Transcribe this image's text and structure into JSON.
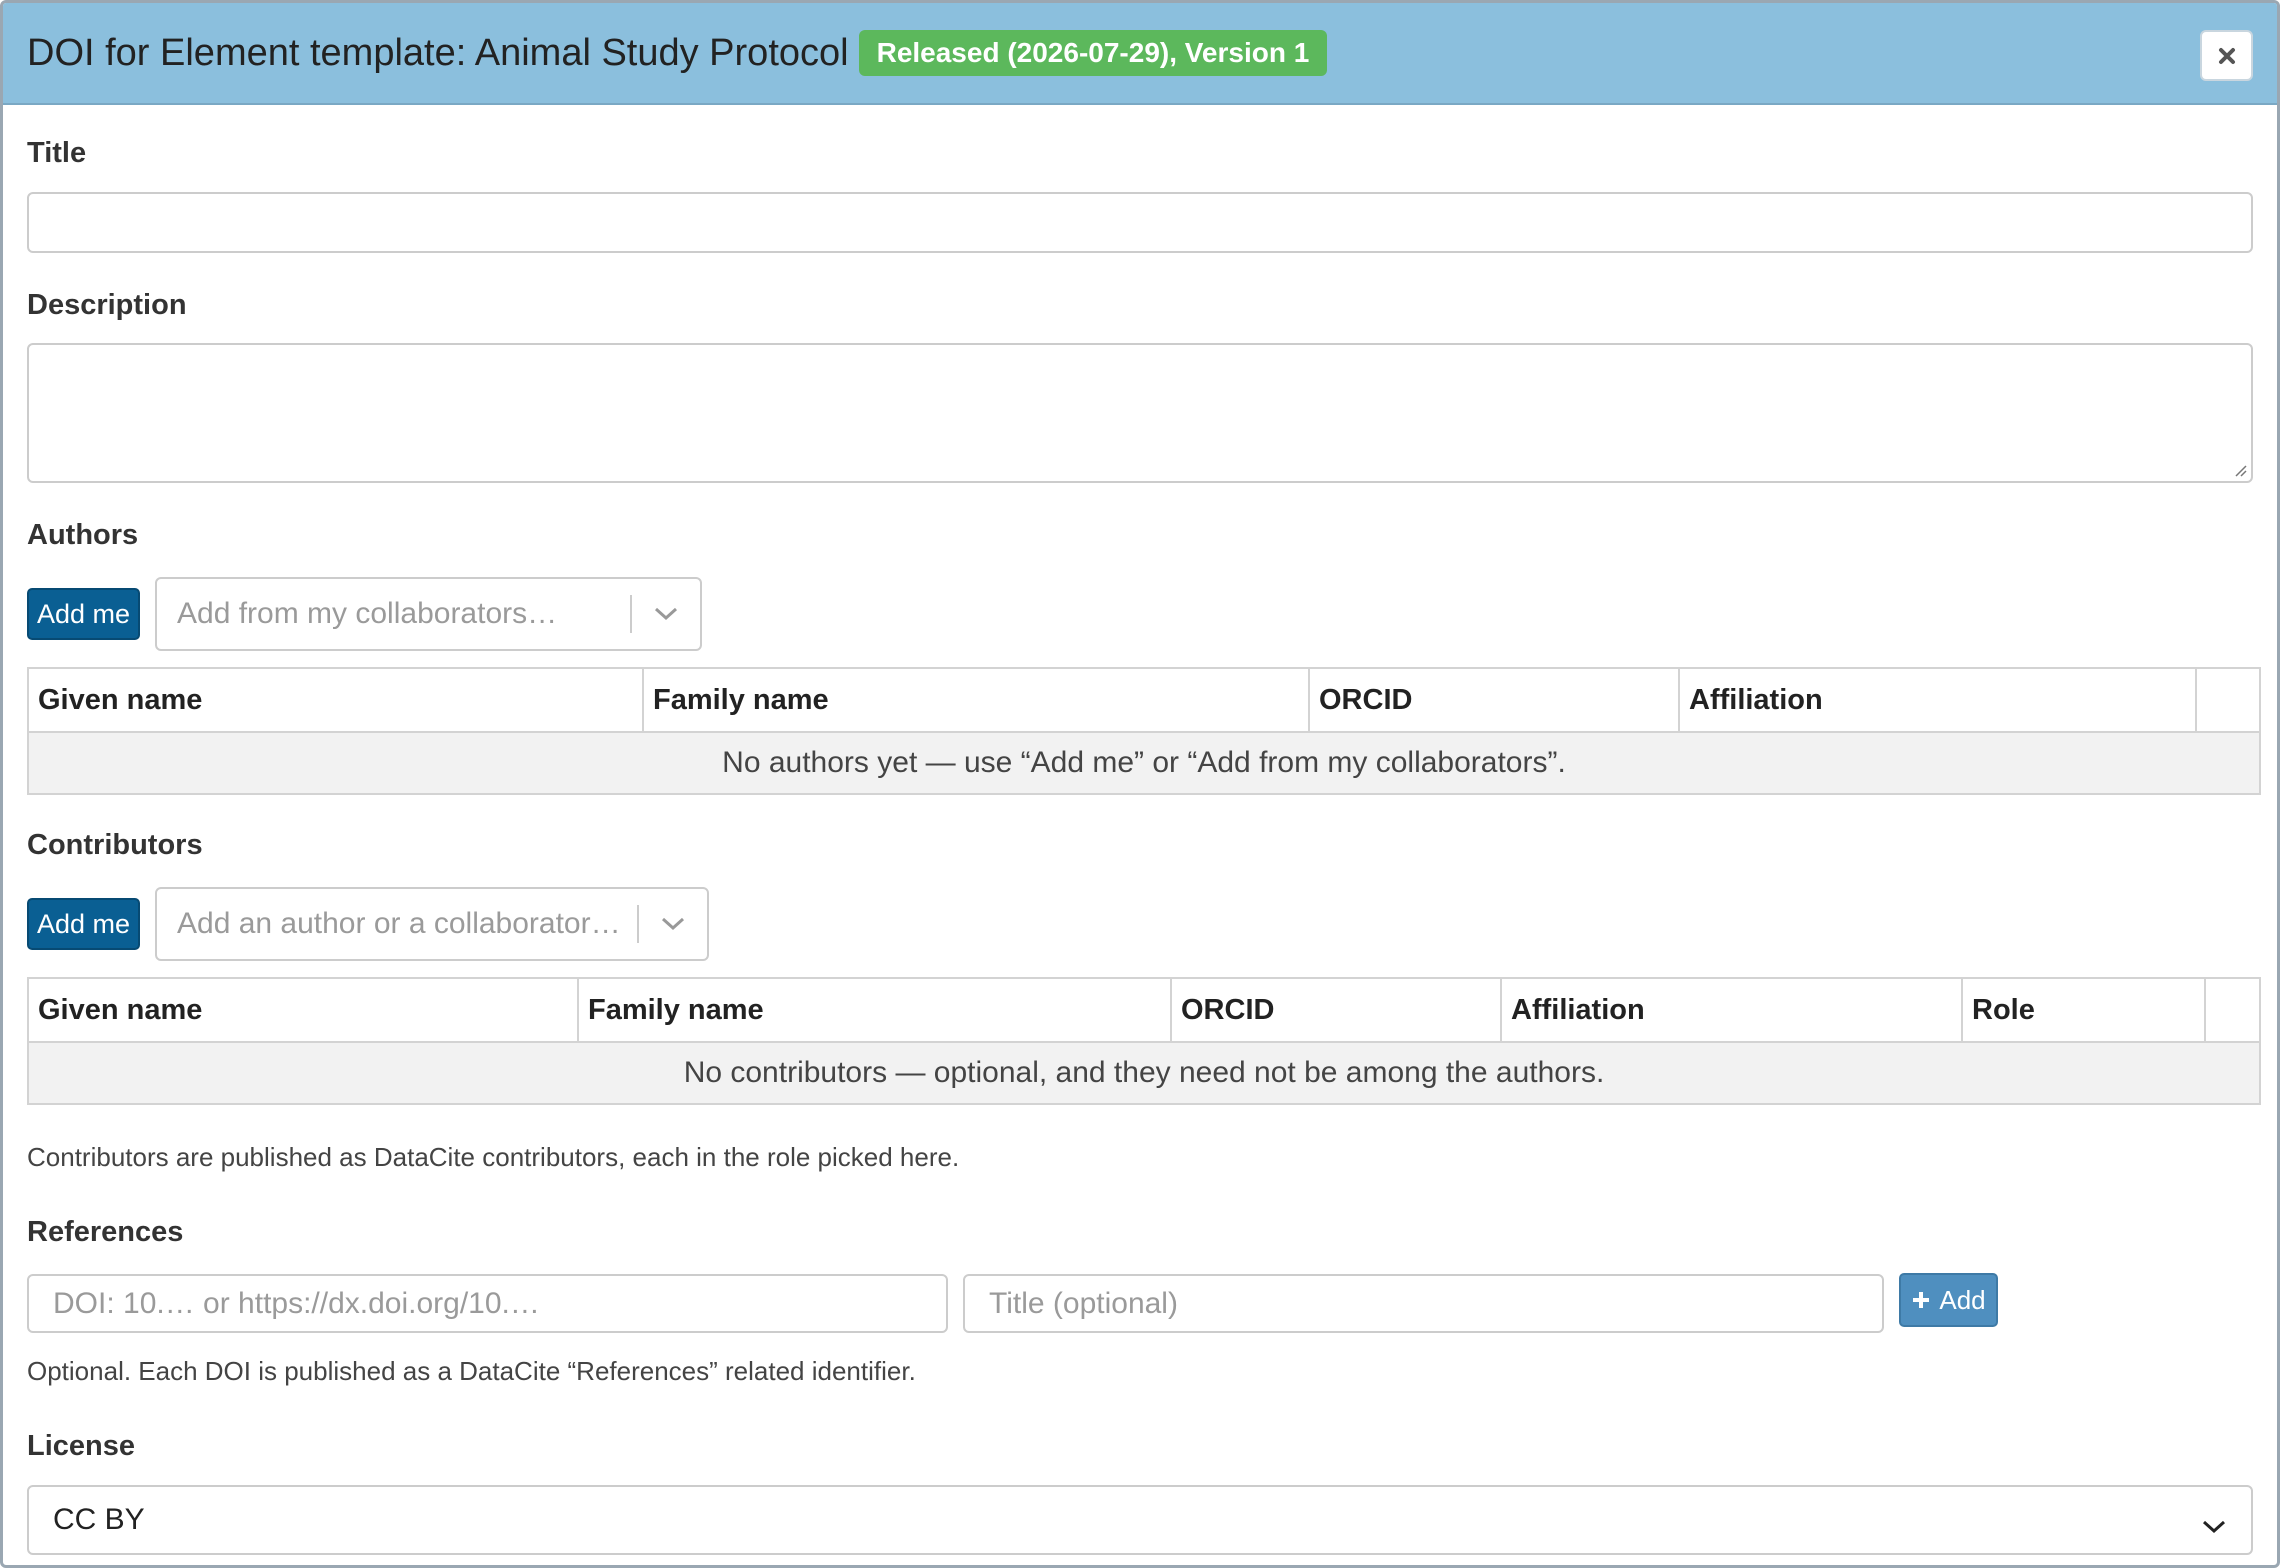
{
  "header": {
    "title": "DOI for Element template: Animal Study Protocol",
    "badge": "Released (2026-07-29), Version 1",
    "close_icon": "close-icon"
  },
  "form": {
    "title_label": "Title",
    "title_value": "",
    "description_label": "Description",
    "description_value": ""
  },
  "authors": {
    "label": "Authors",
    "add_me": "Add me",
    "select_placeholder": "Add from my collaborators…",
    "columns": [
      "Given name",
      "Family name",
      "ORCID",
      "Affiliation",
      ""
    ],
    "empty_text": "No authors yet — use “Add me” or “Add from my collaborators”."
  },
  "contributors": {
    "label": "Contributors",
    "add_me": "Add me",
    "select_placeholder": "Add an author or a collaborator…",
    "columns": [
      "Given name",
      "Family name",
      "ORCID",
      "Affiliation",
      "Role",
      ""
    ],
    "empty_text": "No contributors — optional, and they need not be among the authors.",
    "help": "Contributors are published as DataCite contributors, each in the role picked here."
  },
  "references": {
    "label": "References",
    "doi_placeholder": "DOI: 10.… or https://dx.doi.org/10.…",
    "title_placeholder": "Title (optional)",
    "add_label": "Add",
    "help": "Optional. Each DOI is published as a DataCite “References” related identifier."
  },
  "license": {
    "label": "License",
    "selected": "CC BY"
  },
  "colors": {
    "header_bg": "#8bbfdd",
    "badge_bg": "#5cb85c",
    "primary_button": "#0a5f93",
    "add_button": "#4f8fbf"
  }
}
